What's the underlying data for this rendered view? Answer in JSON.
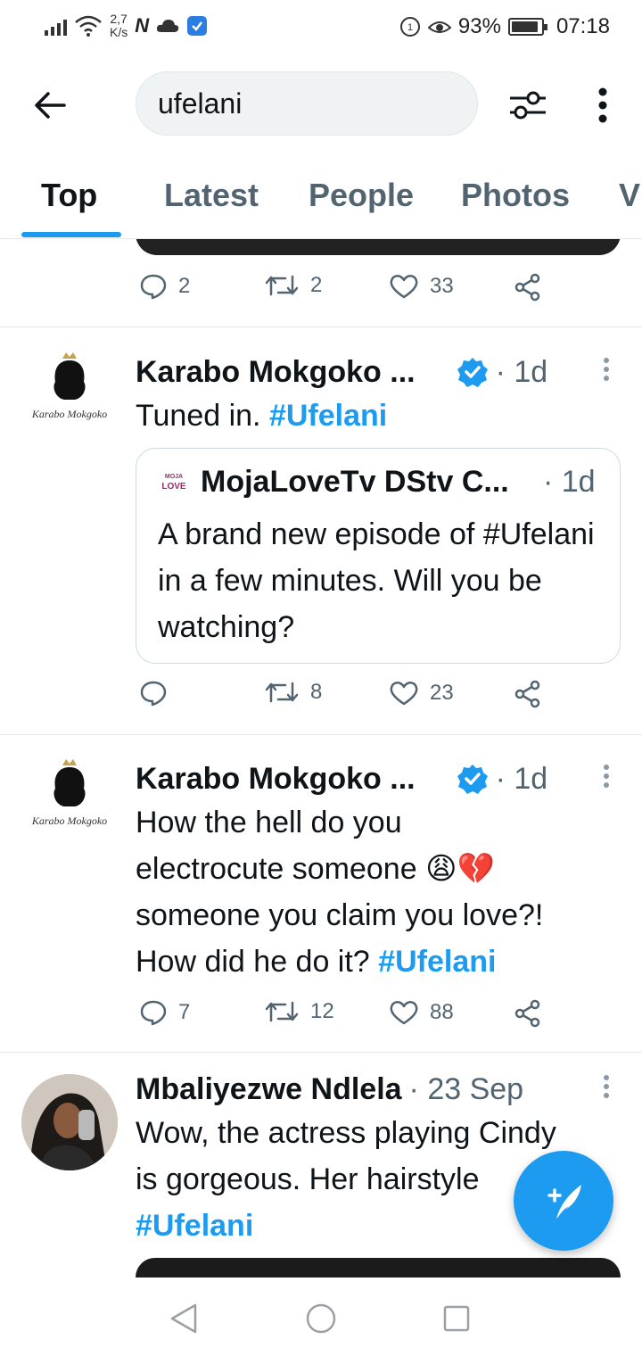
{
  "status_bar": {
    "speed_value": "2,7",
    "speed_unit": "K/s",
    "n_badge": "N",
    "battery": "93%",
    "battery_level": 0.93,
    "time": "07:18"
  },
  "search": {
    "value": "ufelani"
  },
  "tabs": [
    {
      "label": "Top",
      "active": true
    },
    {
      "label": "Latest"
    },
    {
      "label": "People"
    },
    {
      "label": "Photos"
    },
    {
      "label": "V"
    }
  ],
  "feed": {
    "prev_actions": {
      "replies": "2",
      "retweets": "2",
      "likes": "33"
    },
    "tweets": [
      {
        "name": "Karabo Mokgoko ...",
        "time": "· 1d",
        "avatar_caption": "Karabo Mokgoko",
        "text_plain": "Tuned in. ",
        "hashtag": "#Ufelani",
        "quote": {
          "logo_line1": "MOJA",
          "logo_line2": "LOVE",
          "name": "MojaLoveTv DStv C...",
          "time": "· 1d",
          "text": "A brand new episode of #Ufelani in a few minutes. Will you be watching?"
        },
        "actions": {
          "replies": "",
          "retweets": "8",
          "likes": "23"
        }
      },
      {
        "name": "Karabo Mokgoko ...",
        "time": "· 1d",
        "avatar_caption": "Karabo Mokgoko",
        "line1": "How the hell do you",
        "line2": "electrocute someone",
        "emoji": "😩💔",
        "line3": "someone you claim you love?!",
        "line4": "How did he do it? ",
        "hashtag": "#Ufelani",
        "actions": {
          "replies": "7",
          "retweets": "12",
          "likes": "88"
        }
      },
      {
        "name": "Mbaliyezwe Ndlela",
        "time": "· 23 Sep",
        "line1": "Wow, the actress playing Cindy",
        "line2": "is gorgeous. Her hairstyle",
        "hashtag": "#Ufelani"
      }
    ]
  },
  "colors": {
    "accent": "#1d9bf0",
    "text": "#0f1419",
    "muted": "#536471"
  },
  "icons": [
    "back-arrow-icon",
    "filter-icon",
    "more-vertical-icon",
    "reply-icon",
    "retweet-icon",
    "like-icon",
    "share-icon",
    "verified-icon",
    "compose-icon",
    "nav-back-icon",
    "nav-home-icon",
    "nav-recents-icon"
  ]
}
